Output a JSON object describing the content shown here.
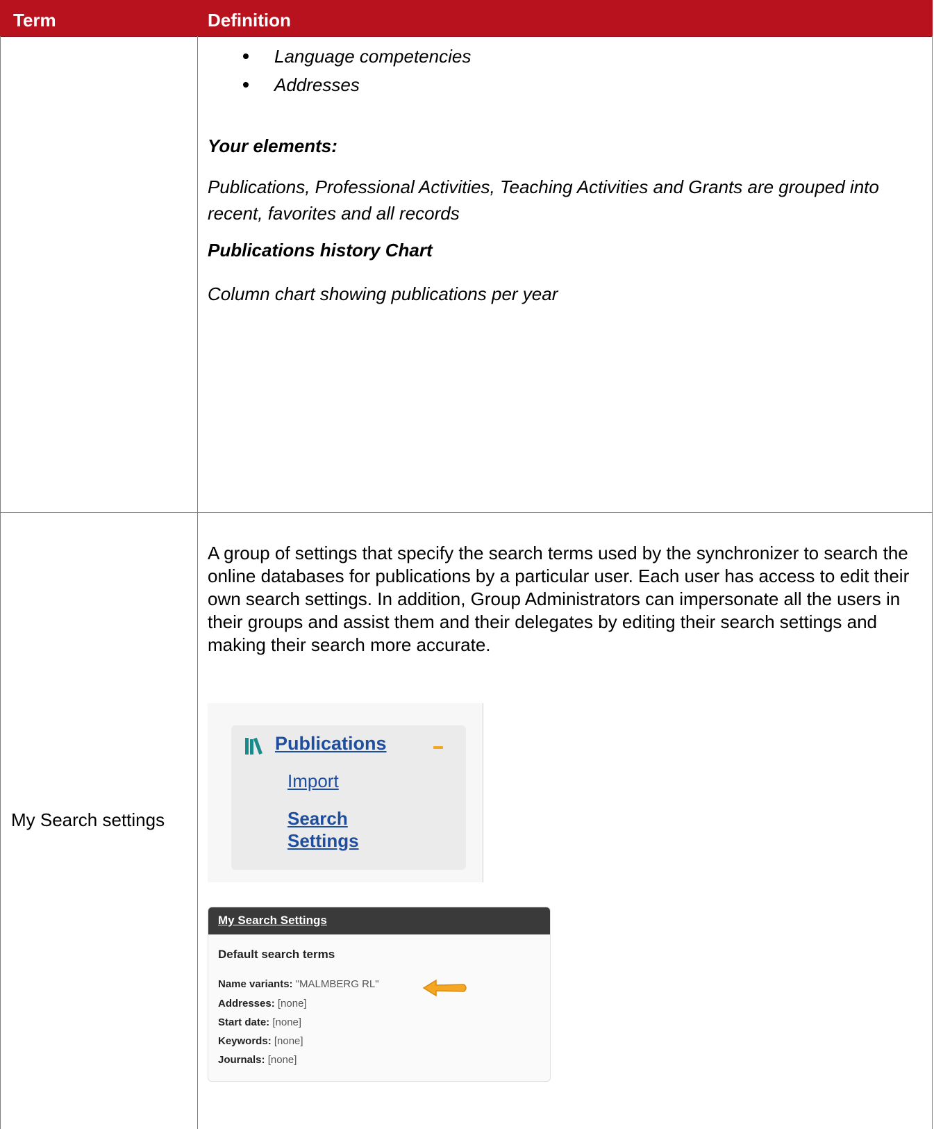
{
  "table": {
    "header_term": "Term",
    "header_definition": "Definition"
  },
  "row1": {
    "bullets": [
      "Language competencies",
      "Addresses"
    ],
    "your_elements_heading": "Your elements:",
    "your_elements_text": "Publications, Professional Activities, Teaching Activities and Grants are grouped into recent, favorites and all records",
    "history_heading": "Publications history Chart",
    "history_text": "Column chart showing publications per year"
  },
  "row2": {
    "term": "My Search settings",
    "definition": "A group of settings that specify the search terms used by the synchronizer to search the online databases for publications by a particular user. Each user has access to edit their own search settings. In addition, Group Administrators can impersonate all the users in their groups and assist them and their delegates by editing their search settings and making their search more accurate.",
    "menu": {
      "publications": "Publications",
      "import": "Import",
      "search_settings": "Search Settings"
    },
    "settings_panel": {
      "title": "My Search Settings",
      "subtitle": "Default search terms",
      "rows": [
        {
          "label": "Name variants:",
          "value": "\"MALMBERG RL\""
        },
        {
          "label": "Addresses:",
          "value": "[none]"
        },
        {
          "label": "Start date:",
          "value": "[none]"
        },
        {
          "label": "Keywords:",
          "value": "[none]"
        },
        {
          "label": "Journals:",
          "value": "[none]"
        }
      ]
    }
  },
  "colors": {
    "header_red": "#b8121f",
    "link_blue": "#1f4e9e",
    "arrow_orange": "#f5a623",
    "icon_teal": "#1a8a8a"
  }
}
